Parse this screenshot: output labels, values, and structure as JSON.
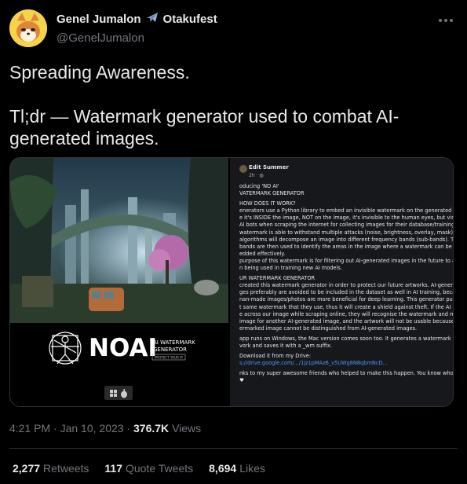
{
  "author": {
    "display_name": "Genel Jumalon",
    "airplane_emoji": "✈️",
    "tag": "Otakufest",
    "handle": "@GenelJumalon"
  },
  "tweet": {
    "line1": "Spreading Awareness.",
    "line2": "Tl;dr — Watermark generator used to combat AI-generated images."
  },
  "media_left": {
    "logo_text": "NOAI",
    "subtitle1": "AI WATERMARK",
    "subtitle2": "GENERATOR",
    "badge": "PROTECT YOUR IP"
  },
  "media_right": {
    "author": "Edit Summer",
    "time": "2h · ",
    "lines": [
      "oducing 'NO AI'",
      "VATERMARK GENERATOR",
      "",
      "HOW DOES IT WORK?",
      "enerators use a Python library to embed an invisible watermark on the generated imag",
      "e it's INSIDE the image, NOT on the image, it's invisible to the human eyes, but visible",
      "AI bots when scraping the internet for collecting images for their database/training.",
      "watermark is able to withstand multiple attacks (noise, brightness, overlay, mask).",
      "algorithms will decompose an image into different frequency bands (sub-bands). Thes",
      "bands are then used to identify the areas in the image where a watermark can be",
      "edded effectively.",
      "purpose of this watermark is for filtering out AI-generated images in the future to avo",
      "n being used in training new AI models.",
      "",
      "UR WATERMARK GENERATOR",
      "created this watermark generator in order to protect our future artworks. AI-generated",
      "ges preferably are avoided to be included in the dataset as well in AI training, because",
      "nan-made images/photos are more beneficial for deep learning. This generator puts th",
      "t same watermark that they use, thus it will create a shield against theft. If the AI bots",
      "e across our image while scraping online, they will recognise the watermark and mista",
      "image for another AI-generated image, and the artwork will not be usable because the",
      "ermarked image cannot be distinguished from AI-generated images.",
      "",
      "app runs on Windows, the Mac version comes soon too. It generates a watermark on",
      "vork and saves it with a _wm suffix.",
      "",
      "Download it from my Drive:",
      "s://drive.google.com/.../1jz1pMAz6_v5UWg8N8qbmNcD...",
      "",
      "nks to my super awesome friends who helped to make this happen. You know who you",
      "♥"
    ],
    "link_index": 27
  },
  "meta": {
    "time": "4:21 PM",
    "date": "Jan 10, 2023",
    "views_count": "376.7K",
    "views_label": "Views"
  },
  "stats": {
    "retweets_count": "2,277",
    "retweets_label": "Retweets",
    "quotes_count": "117",
    "quotes_label": "Quote Tweets",
    "likes_count": "8,694",
    "likes_label": "Likes"
  },
  "colors": {
    "background": "#000000",
    "text": "#e7e9ea",
    "muted": "#71767b",
    "border": "#2f3336",
    "link": "#4599ff"
  }
}
